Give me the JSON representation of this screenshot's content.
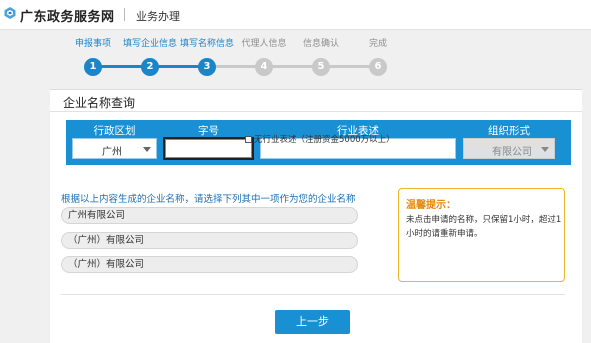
{
  "header": {
    "site_title": "广东政务服务网",
    "section": "业务办理"
  },
  "steps": [
    {
      "num": "1",
      "label": "申报事项",
      "state": "done"
    },
    {
      "num": "2",
      "label": "填写企业信息",
      "state": "done"
    },
    {
      "num": "3",
      "label": "填写名称信息",
      "state": "done"
    },
    {
      "num": "4",
      "label": "代理人信息",
      "state": "todo"
    },
    {
      "num": "5",
      "label": "信息确认",
      "state": "todo"
    },
    {
      "num": "6",
      "label": "完成",
      "state": "todo"
    }
  ],
  "card": {
    "title": "企业名称查询",
    "columns": {
      "region": "行政区划",
      "zihao": "字号",
      "industry": "行业表述",
      "org_form": "组织形式"
    },
    "region_value": "广州",
    "zihao_value": "",
    "industry_value": "",
    "org_form_value": "有限公司",
    "no_industry_label": "无行业表述（注册资金5000万以上）",
    "gen_prompt": "根据以上内容生成的企业名称，请选择下列其中一项作为您的企业名称",
    "name_options": [
      "广州有限公司",
      "（广州）有限公司",
      "（广州）有限公司"
    ],
    "tip": {
      "title": "温馨提示：",
      "body": "未点击申请的名称，只保留1小时，超过1小时的请重新申请。"
    },
    "prev_button": "上一步"
  }
}
